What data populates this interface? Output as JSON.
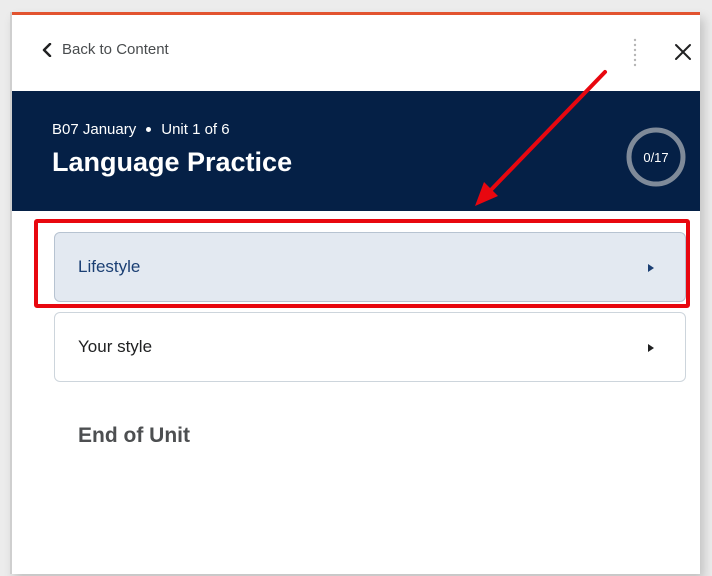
{
  "nav": {
    "back_label": "Back to Content"
  },
  "header": {
    "breadcrumb_course": "B07 January",
    "breadcrumb_unit": "Unit 1 of 6",
    "title": "Language Practice",
    "progress_text": "0/17",
    "progress_fraction": 0,
    "bg_color": "#052046"
  },
  "items": [
    {
      "label": "Lifestyle",
      "active": true
    },
    {
      "label": "Your style",
      "active": false
    }
  ],
  "footer": {
    "end_label": "End of Unit"
  },
  "colors": {
    "accent": "#e2532f",
    "annotation": "#e8070f",
    "active_item_bg": "#e3e9f1"
  },
  "icons": {
    "back": "chevron-left-icon",
    "more": "vertical-dots-icon",
    "close": "close-icon",
    "item_arrow": "caret-right-icon"
  }
}
